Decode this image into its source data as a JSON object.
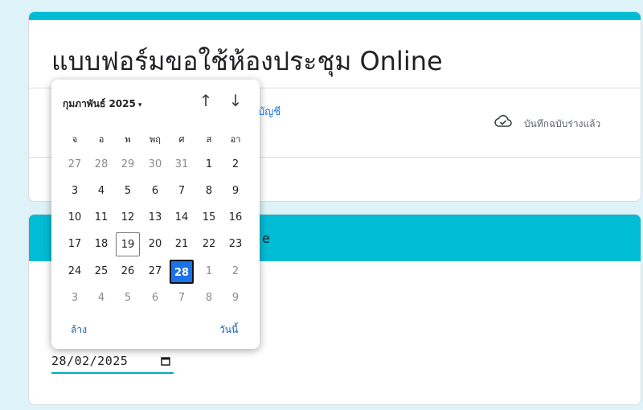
{
  "form": {
    "title": "แบบฟอร์มขอใช้ห้องประชุม Online",
    "account_link": "บัญชี",
    "draft_status": "บันทึกฉบับร่างแล้ว",
    "section_header": "e"
  },
  "date_field": {
    "value": "28/02/2025"
  },
  "datepicker": {
    "month_label": "กุมภาพันธ์ 2025",
    "caret": "▾",
    "nav_up": "↑",
    "nav_down": "↓",
    "weekdays": [
      "จ",
      "อ",
      "พ",
      "พฤ",
      "ศ",
      "ส",
      "อา"
    ],
    "weeks": [
      [
        "27",
        "28",
        "29",
        "30",
        "31",
        "1",
        "2"
      ],
      [
        "3",
        "4",
        "5",
        "6",
        "7",
        "8",
        "9"
      ],
      [
        "10",
        "11",
        "12",
        "13",
        "14",
        "15",
        "16"
      ],
      [
        "17",
        "18",
        "19",
        "20",
        "21",
        "22",
        "23"
      ],
      [
        "24",
        "25",
        "26",
        "27",
        "28",
        "1",
        "2"
      ],
      [
        "3",
        "4",
        "5",
        "6",
        "7",
        "8",
        "9"
      ]
    ],
    "today_day": "19",
    "selected_day": "28",
    "clear_label": "ล้าง",
    "today_label": "วันนี้"
  },
  "colors": {
    "accent": "#00bcd4",
    "background": "#ddf3f7",
    "selected": "#1a73e8"
  },
  "icons": {
    "draft": "cloud-check-icon",
    "calendar": "calendar-icon"
  }
}
